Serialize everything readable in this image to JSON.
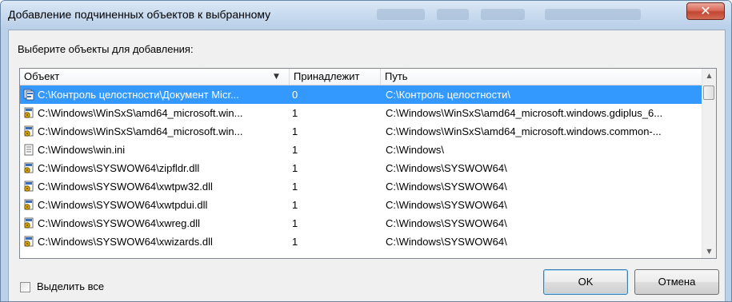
{
  "window": {
    "title": "Добавление подчиненных объектов к выбранному",
    "close_glyph": "✕"
  },
  "prompt": "Выберите объекты для добавления:",
  "columns": {
    "object": "Объект",
    "owner": "Принадлежит",
    "path": "Путь",
    "sort_glyph": "▼"
  },
  "rows": [
    {
      "object": "C:\\Контроль целостности\\Документ Micr...",
      "owner": "0",
      "path": "C:\\Контроль целостности\\",
      "icon": "composite-doc-icon",
      "selected": true
    },
    {
      "object": "C:\\Windows\\WinSxS\\amd64_microsoft.win...",
      "owner": "1",
      "path": "C:\\Windows\\WinSxS\\amd64_microsoft.windows.gdiplus_6...",
      "icon": "dll-gear-icon"
    },
    {
      "object": "C:\\Windows\\WinSxS\\amd64_microsoft.win...",
      "owner": "1",
      "path": "C:\\Windows\\WinSxS\\amd64_microsoft.windows.common-...",
      "icon": "dll-gear-icon"
    },
    {
      "object": "C:\\Windows\\win.ini",
      "owner": "1",
      "path": "C:\\Windows\\",
      "icon": "ini-file-icon"
    },
    {
      "object": "C:\\Windows\\SYSWOW64\\zipfldr.dll",
      "owner": "1",
      "path": "C:\\Windows\\SYSWOW64\\",
      "icon": "dll-gear-icon"
    },
    {
      "object": "C:\\Windows\\SYSWOW64\\xwtpw32.dll",
      "owner": "1",
      "path": "C:\\Windows\\SYSWOW64\\",
      "icon": "dll-gear-icon"
    },
    {
      "object": "C:\\Windows\\SYSWOW64\\xwtpdui.dll",
      "owner": "1",
      "path": "C:\\Windows\\SYSWOW64\\",
      "icon": "dll-gear-icon"
    },
    {
      "object": "C:\\Windows\\SYSWOW64\\xwreg.dll",
      "owner": "1",
      "path": "C:\\Windows\\SYSWOW64\\",
      "icon": "dll-gear-icon"
    },
    {
      "object": "C:\\Windows\\SYSWOW64\\xwizards.dll",
      "owner": "1",
      "path": "C:\\Windows\\SYSWOW64\\",
      "icon": "dll-gear-icon"
    }
  ],
  "scrollbar": {
    "up_glyph": "▲",
    "down_glyph": "▼"
  },
  "select_all": {
    "label": "Выделить все",
    "checked": false
  },
  "buttons": {
    "ok": "OK",
    "cancel": "Отмена"
  },
  "colors": {
    "selection": "#3399ff",
    "close_button": "#c24633",
    "title_bar": "#c6d9ee"
  }
}
